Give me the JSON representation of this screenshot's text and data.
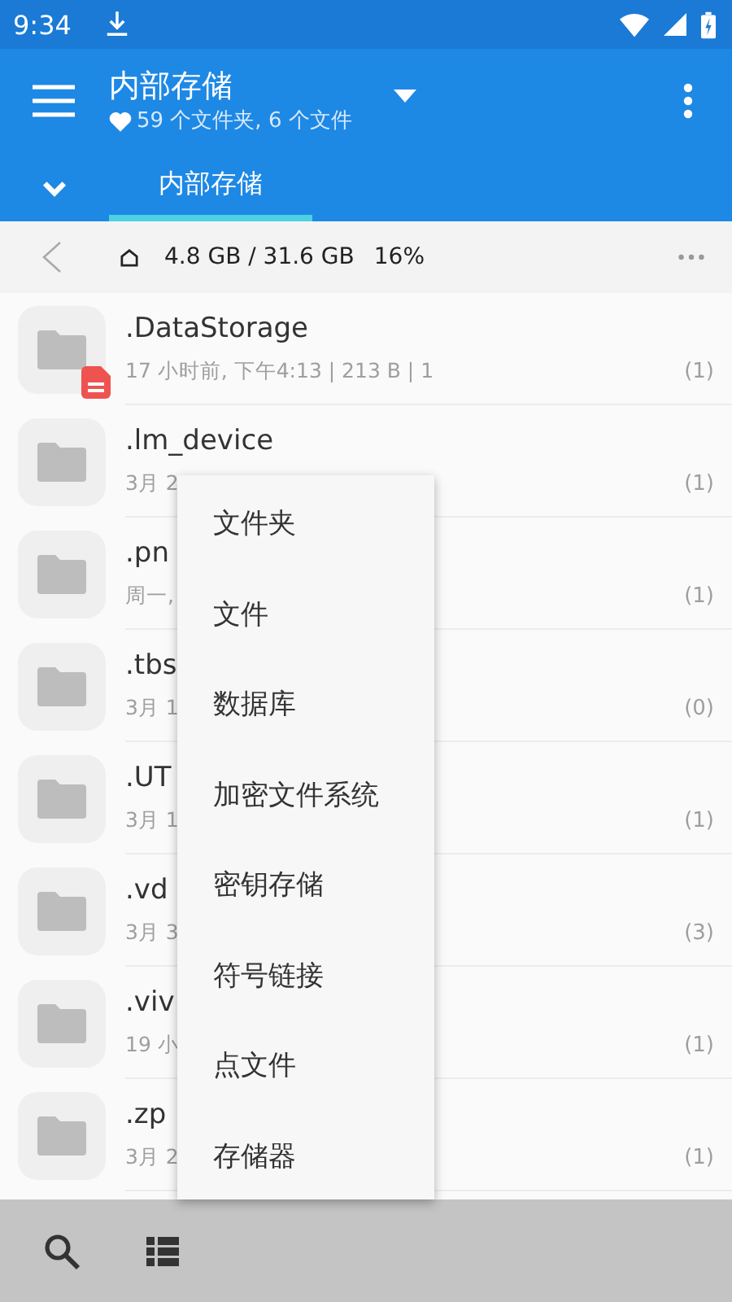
{
  "status_bar": {
    "time": "9:34"
  },
  "toolbar": {
    "title": "内部存储",
    "subtitle": "59 个文件夹, 6 个文件"
  },
  "tabs": [
    {
      "label": "内部存储",
      "selected": true
    }
  ],
  "path_bar": {
    "usage": "4.8 GB / 31.6 GB",
    "percent": "16%"
  },
  "files": [
    {
      "name": ".DataStorage",
      "meta": "17 小时前, 下午4:13 | 213 B | 1",
      "count": "(1)",
      "badge": true
    },
    {
      "name": ".lm_device",
      "meta": "3月 2",
      "count": "(1)",
      "badge": false
    },
    {
      "name": ".pn",
      "meta": "周一,",
      "count": "(1)",
      "badge": false
    },
    {
      "name": ".tbs",
      "meta": "3月 1",
      "count": "(0)",
      "badge": false
    },
    {
      "name": ".UT",
      "meta": "3月 1",
      "count": "(1)",
      "badge": false
    },
    {
      "name": ".vd",
      "meta": "3月 3",
      "count": "(3)",
      "badge": false
    },
    {
      "name": ".viv",
      "meta": "19 小",
      "count": "(1)",
      "badge": false
    },
    {
      "name": ".zp",
      "meta": "3月 2",
      "count": "(1)",
      "badge": false
    }
  ],
  "menu": {
    "items": [
      "文件夹",
      "文件",
      "数据库",
      "加密文件系统",
      "密钥存储",
      "符号链接",
      "点文件",
      "存储器"
    ]
  }
}
